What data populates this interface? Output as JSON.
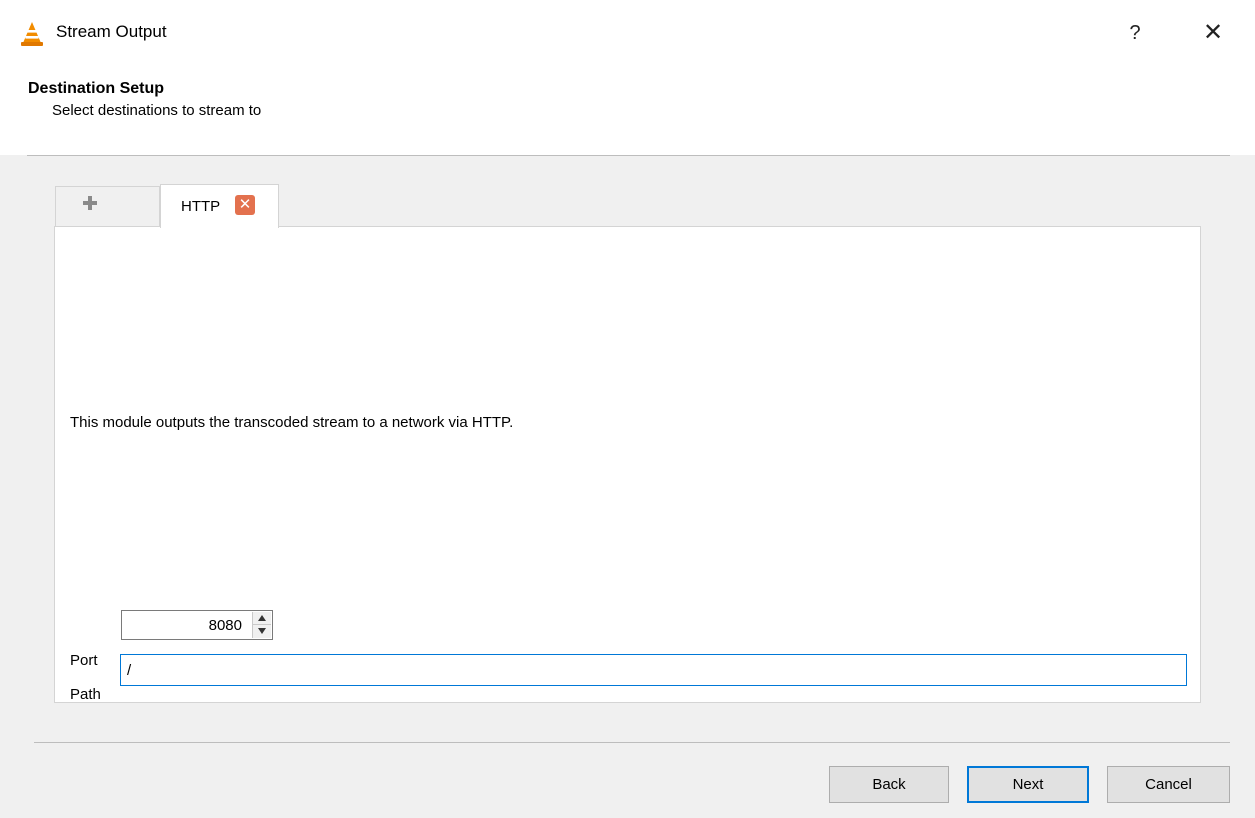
{
  "window": {
    "title": "Stream Output",
    "help": "?",
    "close": "✕"
  },
  "header": {
    "title": "Destination Setup",
    "subtitle": "Select destinations to stream to"
  },
  "tabs": [
    {
      "label": "",
      "icon": "plus-icon"
    },
    {
      "label": "HTTP",
      "icon": "tab-close-icon",
      "close_glyph": "✕"
    }
  ],
  "module": {
    "description": "This module outputs the transcoded stream to a network via HTTP.",
    "port_label": "Port",
    "port_value": "8080",
    "path_label": "Path",
    "path_value": "/"
  },
  "buttons": {
    "back": "Back",
    "next": "Next",
    "cancel": "Cancel"
  },
  "colors": {
    "accent": "#0078d7",
    "tab_close": "#e3714e",
    "vlc_cone": "#f28c00"
  }
}
